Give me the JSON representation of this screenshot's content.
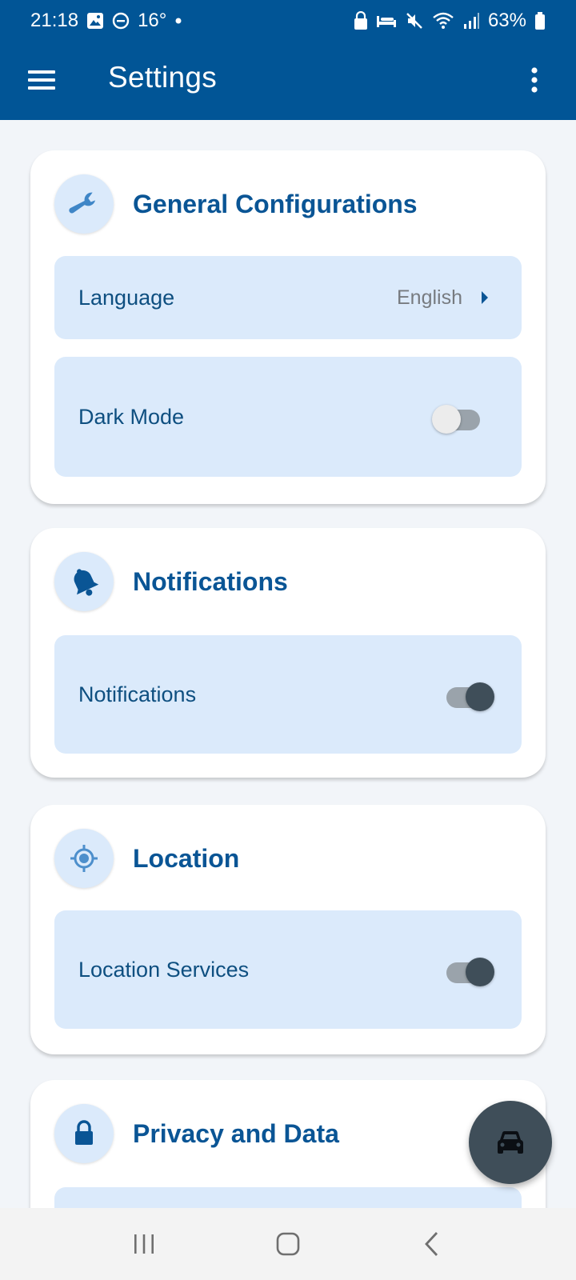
{
  "status_bar": {
    "time": "21:18",
    "temperature": "16°",
    "battery": "63%",
    "icons": [
      "image-icon",
      "do-not-disturb-icon",
      "dot-icon",
      "lock-icon",
      "bed-icon",
      "mute-icon",
      "wifi-icon",
      "signal-icon",
      "battery-icon"
    ]
  },
  "app_bar": {
    "title": "Settings",
    "menu_icon": "hamburger-menu-icon",
    "more_icon": "more-vert-icon"
  },
  "sections": {
    "general": {
      "title": "General Configurations",
      "icon": "wrench-icon",
      "language_label": "Language",
      "language_value": "English",
      "dark_mode_label": "Dark Mode",
      "dark_mode_on": false
    },
    "notifications": {
      "title": "Notifications",
      "icon": "bell-icon",
      "notifications_label": "Notifications",
      "notifications_on": true
    },
    "location": {
      "title": "Location",
      "icon": "crosshair-icon",
      "location_services_label": "Location Services",
      "location_services_on": true
    },
    "privacy": {
      "title": "Privacy and Data",
      "icon": "lock-icon"
    }
  },
  "fab": {
    "icon": "car-icon"
  },
  "nav_bar": {
    "icons": [
      "recents-icon",
      "home-icon",
      "back-icon"
    ]
  },
  "colors": {
    "primary": "#015596",
    "card_row": "#dbeafb",
    "switch_on_thumb": "#3f4e59"
  }
}
